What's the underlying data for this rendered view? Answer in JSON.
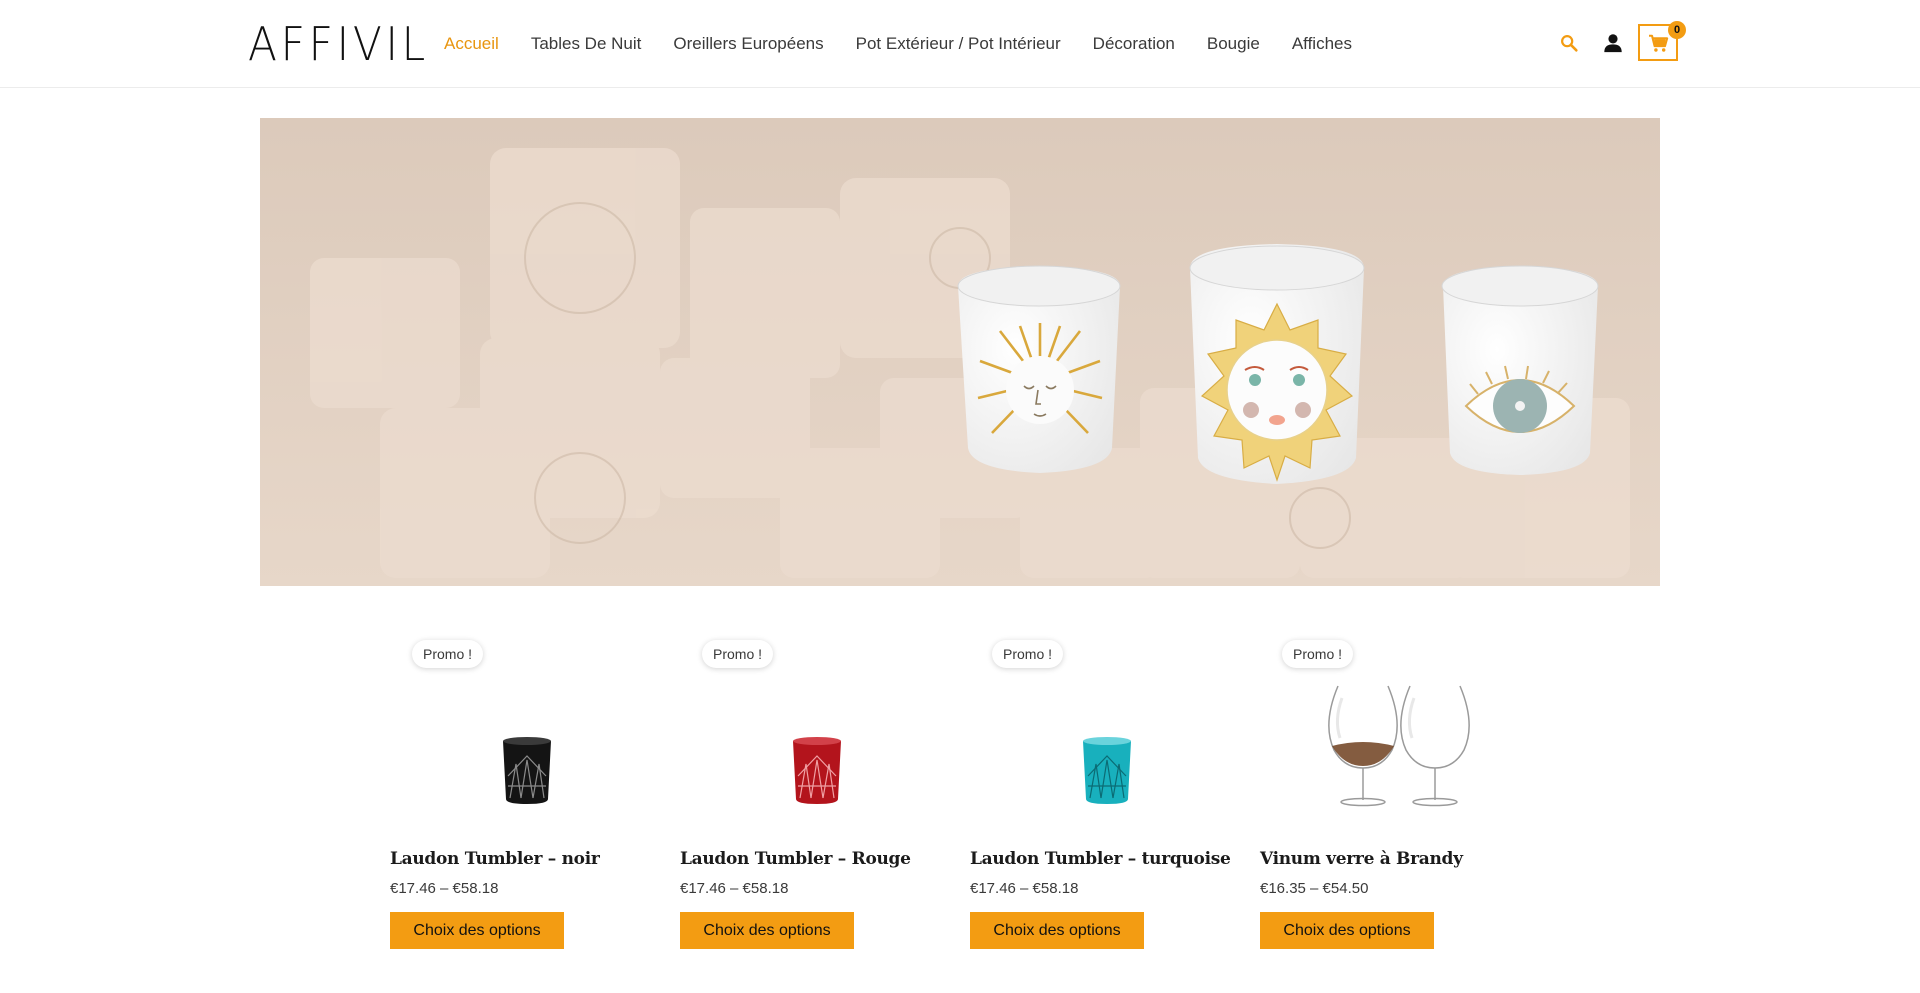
{
  "header": {
    "logo": "AFFIVIL",
    "nav": [
      {
        "label": "Accueil",
        "active": true
      },
      {
        "label": "Tables De Nuit"
      },
      {
        "label": "Oreillers Européens"
      },
      {
        "label": "Pot Extérieur / Pot Intérieur"
      },
      {
        "label": "Décoration"
      },
      {
        "label": "Bougie"
      },
      {
        "label": "Affiches"
      }
    ],
    "cart_count": "0",
    "icons": [
      "search-icon",
      "user-icon",
      "cart-icon"
    ]
  },
  "colors": {
    "accent": "#f39c12",
    "active_nav": "#e8950f",
    "text": "#3a3a3a",
    "hero_bg": "#e2cfbf"
  },
  "products": [
    {
      "promo": "Promo !",
      "title": "Laudon Tumbler – noir",
      "price": "€17.46  –  €58.18",
      "button": "Choix des options",
      "image": "black-crystal-tumbler"
    },
    {
      "promo": "Promo !",
      "title": "Laudon Tumbler – Rouge",
      "price": "€17.46  –  €58.18",
      "button": "Choix des options",
      "image": "red-crystal-tumbler"
    },
    {
      "promo": "Promo !",
      "title": "Laudon Tumbler – turquoise",
      "price": "€17.46  –  €58.18",
      "button": "Choix des options",
      "image": "turquoise-crystal-tumbler"
    },
    {
      "promo": "Promo !",
      "title": "Vinum verre à Brandy",
      "price": "€16.35  –  €54.50",
      "button": "Choix des options",
      "image": "brandy-glasses"
    }
  ]
}
